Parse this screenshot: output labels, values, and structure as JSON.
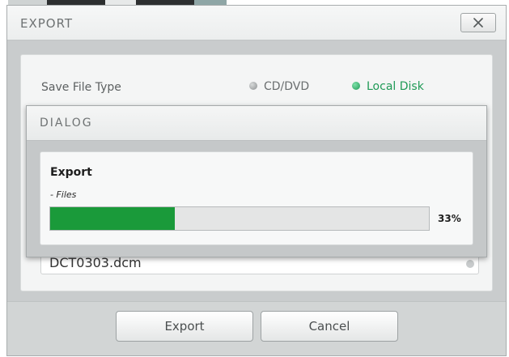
{
  "window": {
    "title": "EXPORT"
  },
  "save_file_type": {
    "label": "Save File Type",
    "options": [
      {
        "label": "CD/DVD",
        "selected": false
      },
      {
        "label": "Local Disk",
        "selected": true
      }
    ]
  },
  "file_field": {
    "value": "DCT0303.dcm"
  },
  "buttons": {
    "export_label": "Export",
    "cancel_label": "Cancel"
  },
  "dialog": {
    "title": "DIALOG",
    "heading": "Export",
    "subtext": "- Files",
    "progress_value": 33,
    "progress_text": "33%"
  },
  "colors": {
    "accent_green": "#1a9a3a",
    "selected_radio": "#1f9a56"
  }
}
